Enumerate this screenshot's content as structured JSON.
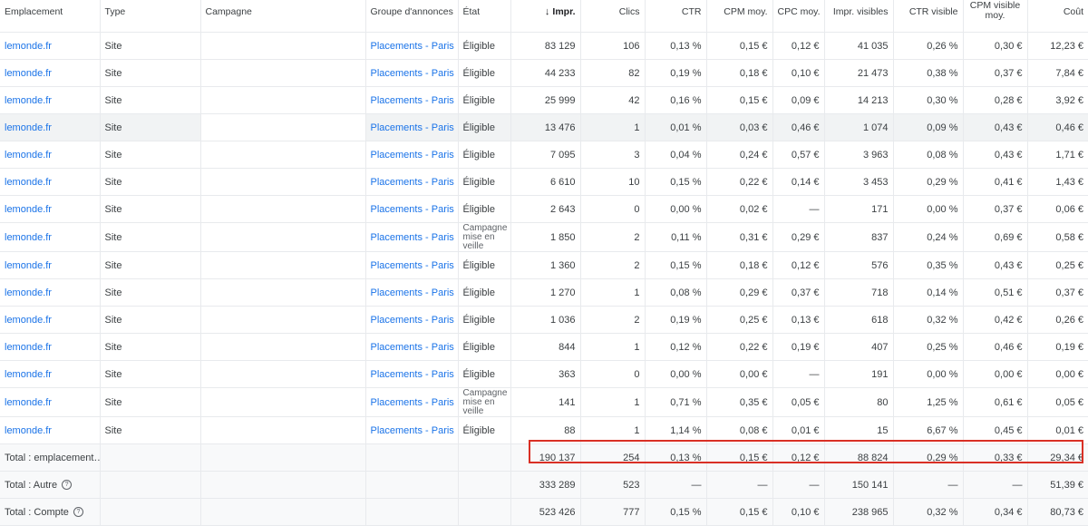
{
  "headers": {
    "emplacement": "Emplacement",
    "type": "Type",
    "campagne": "Campagne",
    "groupe": "Groupe d'annonces",
    "etat": "État",
    "impr": "Impr.",
    "clics": "Clics",
    "ctr": "CTR",
    "cpm": "CPM moy.",
    "cpc": "CPC moy.",
    "impr_visibles": "Impr. visibles",
    "ctr_visible": "CTR visible",
    "cpm_visible": "CPM visible moy.",
    "cout": "Coût"
  },
  "sort_icon": "arrow-down-icon",
  "rows": [
    {
      "empl": "lemonde.fr",
      "type": "Site",
      "campagne": "",
      "groupe": "Placements - Paris",
      "etat": "Éligible",
      "impr": "83 129",
      "clics": "106",
      "ctr": "0,13 %",
      "cpm": "0,15 €",
      "cpc": "0,12 €",
      "iv": "41 035",
      "ctrv": "0,26 %",
      "cpmv": "0,30 €",
      "cout": "12,23 €"
    },
    {
      "empl": "lemonde.fr",
      "type": "Site",
      "campagne": "",
      "groupe": "Placements - Paris",
      "etat": "Éligible",
      "impr": "44 233",
      "clics": "82",
      "ctr": "0,19 %",
      "cpm": "0,18 €",
      "cpc": "0,10 €",
      "iv": "21 473",
      "ctrv": "0,38 %",
      "cpmv": "0,37 €",
      "cout": "7,84 €"
    },
    {
      "empl": "lemonde.fr",
      "type": "Site",
      "campagne": "",
      "groupe": "Placements - Paris",
      "etat": "Éligible",
      "impr": "25 999",
      "clics": "42",
      "ctr": "0,16 %",
      "cpm": "0,15 €",
      "cpc": "0,09 €",
      "iv": "14 213",
      "ctrv": "0,30 %",
      "cpmv": "0,28 €",
      "cout": "3,92 €"
    },
    {
      "empl": "lemonde.fr",
      "type": "Site",
      "campagne": "",
      "groupe": "Placements - Paris",
      "etat": "Éligible",
      "impr": "13 476",
      "clics": "1",
      "ctr": "0,01 %",
      "cpm": "0,03 €",
      "cpc": "0,46 €",
      "iv": "1 074",
      "ctrv": "0,09 %",
      "cpmv": "0,43 €",
      "cout": "0,46 €"
    },
    {
      "empl": "lemonde.fr",
      "type": "Site",
      "campagne": "",
      "groupe": "Placements - Paris",
      "etat": "Éligible",
      "impr": "7 095",
      "clics": "3",
      "ctr": "0,04 %",
      "cpm": "0,24 €",
      "cpc": "0,57 €",
      "iv": "3 963",
      "ctrv": "0,08 %",
      "cpmv": "0,43 €",
      "cout": "1,71 €"
    },
    {
      "empl": "lemonde.fr",
      "type": "Site",
      "campagne": "",
      "groupe": "Placements - Paris",
      "etat": "Éligible",
      "impr": "6 610",
      "clics": "10",
      "ctr": "0,15 %",
      "cpm": "0,22 €",
      "cpc": "0,14 €",
      "iv": "3 453",
      "ctrv": "0,29 %",
      "cpmv": "0,41 €",
      "cout": "1,43 €"
    },
    {
      "empl": "lemonde.fr",
      "type": "Site",
      "campagne": "",
      "groupe": "Placements - Paris",
      "etat": "Éligible",
      "impr": "2 643",
      "clics": "0",
      "ctr": "0,00 %",
      "cpm": "0,02 €",
      "cpc": "—",
      "iv": "171",
      "ctrv": "0,00 %",
      "cpmv": "0,37 €",
      "cout": "0,06 €"
    },
    {
      "empl": "lemonde.fr",
      "type": "Site",
      "campagne": "",
      "groupe": "Placements - Paris",
      "etat": "Campagne mise en veille",
      "impr": "1 850",
      "clics": "2",
      "ctr": "0,11 %",
      "cpm": "0,31 €",
      "cpc": "0,29 €",
      "iv": "837",
      "ctrv": "0,24 %",
      "cpmv": "0,69 €",
      "cout": "0,58 €"
    },
    {
      "empl": "lemonde.fr",
      "type": "Site",
      "campagne": "",
      "groupe": "Placements - Paris",
      "etat": "Éligible",
      "impr": "1 360",
      "clics": "2",
      "ctr": "0,15 %",
      "cpm": "0,18 €",
      "cpc": "0,12 €",
      "iv": "576",
      "ctrv": "0,35 %",
      "cpmv": "0,43 €",
      "cout": "0,25 €"
    },
    {
      "empl": "lemonde.fr",
      "type": "Site",
      "campagne": "",
      "groupe": "Placements - Paris",
      "etat": "Éligible",
      "impr": "1 270",
      "clics": "1",
      "ctr": "0,08 %",
      "cpm": "0,29 €",
      "cpc": "0,37 €",
      "iv": "718",
      "ctrv": "0,14 %",
      "cpmv": "0,51 €",
      "cout": "0,37 €"
    },
    {
      "empl": "lemonde.fr",
      "type": "Site",
      "campagne": "",
      "groupe": "Placements - Paris",
      "etat": "Éligible",
      "impr": "1 036",
      "clics": "2",
      "ctr": "0,19 %",
      "cpm": "0,25 €",
      "cpc": "0,13 €",
      "iv": "618",
      "ctrv": "0,32 %",
      "cpmv": "0,42 €",
      "cout": "0,26 €"
    },
    {
      "empl": "lemonde.fr",
      "type": "Site",
      "campagne": "",
      "groupe": "Placements - Paris",
      "etat": "Éligible",
      "impr": "844",
      "clics": "1",
      "ctr": "0,12 %",
      "cpm": "0,22 €",
      "cpc": "0,19 €",
      "iv": "407",
      "ctrv": "0,25 %",
      "cpmv": "0,46 €",
      "cout": "0,19 €"
    },
    {
      "empl": "lemonde.fr",
      "type": "Site",
      "campagne": "",
      "groupe": "Placements - Paris",
      "etat": "Éligible",
      "impr": "363",
      "clics": "0",
      "ctr": "0,00 %",
      "cpm": "0,00 €",
      "cpc": "—",
      "iv": "191",
      "ctrv": "0,00 %",
      "cpmv": "0,00 €",
      "cout": "0,00 €"
    },
    {
      "empl": "lemonde.fr",
      "type": "Site",
      "campagne": "",
      "groupe": "Placements - Paris",
      "etat": "Campagne mise en veille",
      "impr": "141",
      "clics": "1",
      "ctr": "0,71 %",
      "cpm": "0,35 €",
      "cpc": "0,05 €",
      "iv": "80",
      "ctrv": "1,25 %",
      "cpmv": "0,61 €",
      "cout": "0,05 €"
    },
    {
      "empl": "lemonde.fr",
      "type": "Site",
      "campagne": "",
      "groupe": "Placements - Paris",
      "etat": "Éligible",
      "impr": "88",
      "clics": "1",
      "ctr": "1,14 %",
      "cpm": "0,08 €",
      "cpc": "0,01 €",
      "iv": "15",
      "ctrv": "6,67 %",
      "cpmv": "0,45 €",
      "cout": "0,01 €"
    }
  ],
  "totals": [
    {
      "label": "Total : emplacement…",
      "help": false,
      "impr": "190 137",
      "clics": "254",
      "ctr": "0,13 %",
      "cpm": "0,15 €",
      "cpc": "0,12 €",
      "iv": "88 824",
      "ctrv": "0,29 %",
      "cpmv": "0,33 €",
      "cout": "29,34 €"
    },
    {
      "label": "Total : Autre",
      "help": true,
      "impr": "333 289",
      "clics": "523",
      "ctr": "—",
      "cpm": "—",
      "cpc": "—",
      "iv": "150 141",
      "ctrv": "—",
      "cpmv": "—",
      "cout": "51,39 €"
    },
    {
      "label": "Total : Compte",
      "help": true,
      "impr": "523 426",
      "clics": "777",
      "ctr": "0,15 %",
      "cpm": "0,15 €",
      "cpc": "0,10 €",
      "iv": "238 965",
      "ctrv": "0,32 %",
      "cpmv": "0,34 €",
      "cout": "80,73 €"
    }
  ],
  "help_icon": "help-circle-icon",
  "highlight_color": "#d93025",
  "link_color": "#1a73e8"
}
